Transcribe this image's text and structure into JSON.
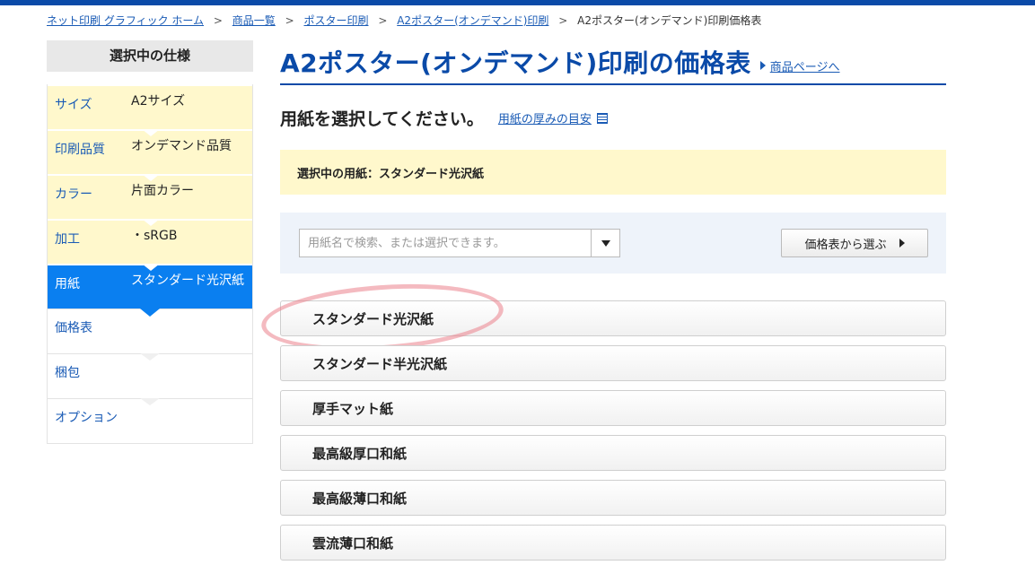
{
  "breadcrumb": {
    "items": [
      "ネット印刷 グラフィック ホーム",
      "商品一覧",
      "ポスター印刷",
      "A2ポスター(オンデマンド)印刷"
    ],
    "current": "A2ポスター(オンデマンド)印刷価格表",
    "separator": ">"
  },
  "sidebar": {
    "heading": "選択中の仕様",
    "items": [
      {
        "label": "サイズ",
        "value": "A2サイズ"
      },
      {
        "label": "印刷品質",
        "value": "オンデマンド品質"
      },
      {
        "label": "カラー",
        "value": "片面カラー"
      },
      {
        "label": "加工",
        "value": "・sRGB"
      },
      {
        "label": "用紙",
        "value": "スタンダード光沢紙"
      },
      {
        "label": "価格表",
        "value": ""
      },
      {
        "label": "梱包",
        "value": ""
      },
      {
        "label": "オプション",
        "value": ""
      }
    ]
  },
  "main": {
    "title": "A2ポスター(オンデマンド)印刷の価格表",
    "product_link": "商品ページへ",
    "subtitle": "用紙を選択してください。",
    "thickness_link": "用紙の厚みの目安",
    "selected_paper": "選択中の用紙：スタンダード光沢紙",
    "search": {
      "placeholder": "用紙名で検索、または選択できます。",
      "value": ""
    },
    "price_button": "価格表から選ぶ",
    "papers": [
      "スタンダード光沢紙",
      "スタンダード半光沢紙",
      "厚手マット紙",
      "最高級厚口和紙",
      "最高級薄口和紙",
      "雲流薄口和紙"
    ]
  },
  "colors": {
    "brand_blue": "#0a4aa8",
    "active_blue": "#0a7ff0",
    "highlight_yellow": "#fff8cc",
    "annotation_pink": "#eb828c"
  }
}
